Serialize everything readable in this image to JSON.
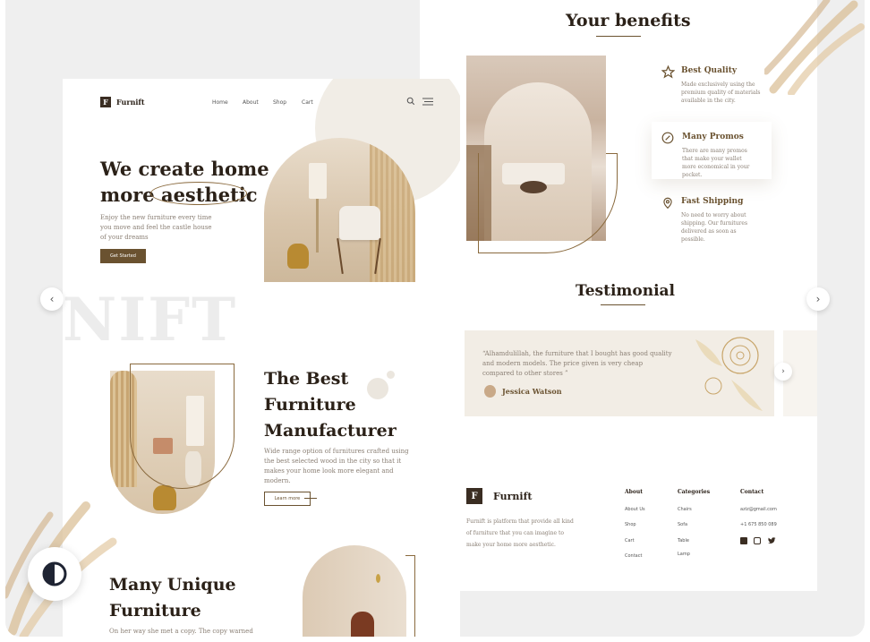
{
  "left": {
    "brand": "Furnift",
    "logo_letter": "F",
    "nav": [
      "Home",
      "About",
      "Shop",
      "Cart"
    ],
    "hero": {
      "line1": "We create home",
      "line2a": "more ",
      "line2b": "aesthetic",
      "desc": "Enjoy the new furniture every time you move and feel the castle house of your dreams",
      "cta": "Get Started"
    },
    "watermark": "NIFT",
    "best": {
      "title_line1": "The Best",
      "title_line2": "Furniture",
      "title_line3": "Manufacturer",
      "desc": "Wide range option of furnitures crafted using the best selected wood in the city so that it makes your home look more elegant and modern.",
      "cta": "Learn more"
    },
    "unique": {
      "line1": "Many Unique",
      "line2": "Furniture",
      "desc": "On her way she met a copy. The copy warned"
    }
  },
  "right": {
    "benefits_title": "Your benefits",
    "benefits": [
      {
        "title": "Best Quality",
        "desc": "Made exclusively using the premium quality of materials available in the city.",
        "icon": "star-icon"
      },
      {
        "title": "Many Promos",
        "desc": "There are many promos that make your wallet more economical in your pocket.",
        "icon": "percent-icon"
      },
      {
        "title": "Fast Shipping",
        "desc": "No need to worry about shipping. Our furnitures delivered as soon as possible.",
        "icon": "location-pin-icon"
      }
    ],
    "testimonial_title": "Testimonial",
    "testimonial_quote": "“Alhamdulillah, the furniture that I bought has good quality and modern models. The price given is very cheap compared to other stores ”",
    "testimonial_author": "Jessica Watson",
    "footer": {
      "brand": "Furnift",
      "logo_letter": "F",
      "desc": "Furnift is platform that provide all kind of furniture that you can imagine to make your home more aesthetic.",
      "about_title": "About",
      "about_links": [
        "About Us",
        "Shop",
        "Cart",
        "Contact"
      ],
      "categories_title": "Categories",
      "categories_links": [
        "Chairs",
        "Sofa",
        "Table",
        "Lamp"
      ],
      "contact_title": "Contact",
      "email": "aziz@gmail.com",
      "phone": "+1 675 850 089"
    }
  },
  "colors": {
    "accent": "#6a5230",
    "dark": "#2b2118",
    "muted": "#8a7f74",
    "bg": "#efefef"
  }
}
